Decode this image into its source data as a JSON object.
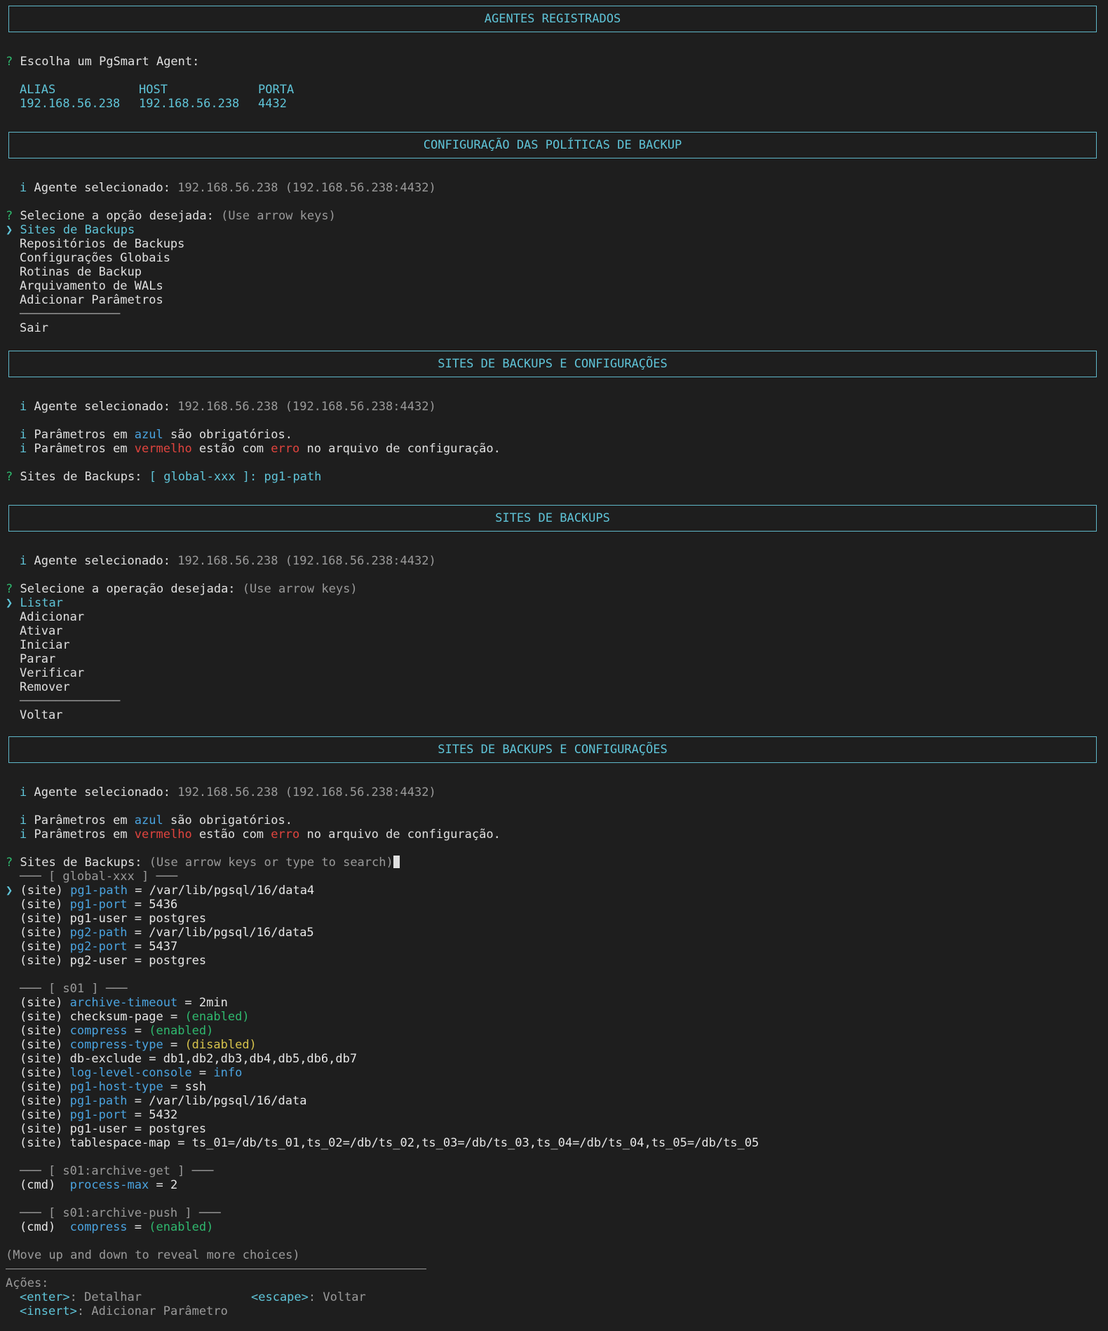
{
  "s1": {
    "title": "AGENTES REGISTRADOS",
    "q_mark": "?",
    "prompt": "Escolha um PgSmart Agent:",
    "cols": [
      "ALIAS",
      "HOST",
      "PORTA"
    ],
    "row": [
      "192.168.56.238",
      "192.168.56.238",
      "4432"
    ]
  },
  "s2": {
    "title": "CONFIGURAÇÃO DAS POLÍTICAS DE BACKUP",
    "info_mark": "i",
    "agent_label": "Agente selecionado:",
    "agent_value": "192.168.56.238 (192.168.56.238:4432)",
    "q_mark": "?",
    "prompt": "Selecione a opção desejada:",
    "hint": "(Use arrow keys)",
    "pointer": "❯",
    "options": [
      "Sites de Backups",
      "Repositórios de Backups",
      "Configurações Globais",
      "Rotinas de Backup",
      "Arquivamento de WALs",
      "Adicionar Parâmetros"
    ],
    "separator": "──────────────",
    "exit": "Sair"
  },
  "s3": {
    "title": "SITES DE BACKUPS E CONFIGURAÇÕES",
    "info_mark": "i",
    "agent_label": "Agente selecionado:",
    "agent_value": "192.168.56.238 (192.168.56.238:4432)",
    "p1_pre": "Parâmetros em ",
    "p1_color": "azul",
    "p1_post": " são obrigatórios.",
    "p2_pre": "Parâmetros em ",
    "p2_color": "vermelho",
    "p2_mid": " estão com ",
    "p2_err": "erro",
    "p2_post": " no arquivo de configuração.",
    "q_mark": "?",
    "prompt": "Sites de Backups:",
    "answer": "[ global-xxx ]: pg1-path"
  },
  "s4": {
    "title": "SITES DE BACKUPS",
    "info_mark": "i",
    "agent_label": "Agente selecionado:",
    "agent_value": "192.168.56.238 (192.168.56.238:4432)",
    "q_mark": "?",
    "prompt": "Selecione a operação desejada:",
    "hint": "(Use arrow keys)",
    "pointer": "❯",
    "options": [
      "Listar",
      "Adicionar",
      "Ativar",
      "Iniciar",
      "Parar",
      "Verificar",
      "Remover"
    ],
    "separator": "──────────────",
    "back": "Voltar"
  },
  "s5": {
    "title": "SITES DE BACKUPS E CONFIGURAÇÕES",
    "info_mark": "i",
    "agent_label": "Agente selecionado:",
    "agent_value": "192.168.56.238 (192.168.56.238:4432)",
    "p1_pre": "Parâmetros em ",
    "p1_color": "azul",
    "p1_post": " são obrigatórios.",
    "p2_pre": "Parâmetros em ",
    "p2_color": "vermelho",
    "p2_mid": " estão com ",
    "p2_err": "erro",
    "p2_post": " no arquivo de configuração.",
    "q_mark": "?",
    "prompt": "Sites de Backups:",
    "hint": "(Use arrow keys or type to search)",
    "pointer": "❯",
    "groups": [
      {
        "header": "─── [ global-xxx ] ───",
        "items": [
          {
            "tag": "(site) ",
            "key": "pg1-path",
            "kc": "blue",
            "eq": " = ",
            "val": "/var/lib/pgsql/16/data4",
            "vc": "white",
            "sel": true
          },
          {
            "tag": "(site) ",
            "key": "pg1-port",
            "kc": "blue",
            "eq": " = ",
            "val": "5436",
            "vc": "white"
          },
          {
            "tag": "(site) ",
            "key": "pg1-user",
            "kc": "white",
            "eq": " = ",
            "val": "postgres",
            "vc": "white"
          },
          {
            "tag": "(site) ",
            "key": "pg2-path",
            "kc": "blue",
            "eq": " = ",
            "val": "/var/lib/pgsql/16/data5",
            "vc": "white"
          },
          {
            "tag": "(site) ",
            "key": "pg2-port",
            "kc": "blue",
            "eq": " = ",
            "val": "5437",
            "vc": "white"
          },
          {
            "tag": "(site) ",
            "key": "pg2-user",
            "kc": "white",
            "eq": " = ",
            "val": "postgres",
            "vc": "white"
          }
        ]
      },
      {
        "header": "─── [ s01 ] ───",
        "items": [
          {
            "tag": "(site) ",
            "key": "archive-timeout",
            "kc": "blue",
            "eq": " = ",
            "val": "2min",
            "vc": "white"
          },
          {
            "tag": "(site) ",
            "key": "checksum-page",
            "kc": "white",
            "eq": " = ",
            "val": "(enabled)",
            "vc": "green"
          },
          {
            "tag": "(site) ",
            "key": "compress",
            "kc": "blue",
            "eq": " = ",
            "val": "(enabled)",
            "vc": "green"
          },
          {
            "tag": "(site) ",
            "key": "compress-type",
            "kc": "blue",
            "eq": " = ",
            "val": "(disabled)",
            "vc": "yellow"
          },
          {
            "tag": "(site) ",
            "key": "db-exclude",
            "kc": "white",
            "eq": " = ",
            "val": "db1,db2,db3,db4,db5,db6,db7",
            "vc": "white"
          },
          {
            "tag": "(site) ",
            "key": "log-level-console",
            "kc": "blue",
            "eq": " = ",
            "val": "info",
            "vc": "blue"
          },
          {
            "tag": "(site) ",
            "key": "pg1-host-type",
            "kc": "blue",
            "eq": " = ",
            "val": "ssh",
            "vc": "white"
          },
          {
            "tag": "(site) ",
            "key": "pg1-path",
            "kc": "blue",
            "eq": " = ",
            "val": "/var/lib/pgsql/16/data",
            "vc": "white"
          },
          {
            "tag": "(site) ",
            "key": "pg1-port",
            "kc": "blue",
            "eq": " = ",
            "val": "5432",
            "vc": "white"
          },
          {
            "tag": "(site) ",
            "key": "pg1-user",
            "kc": "white",
            "eq": " = ",
            "val": "postgres",
            "vc": "white"
          },
          {
            "tag": "(site) ",
            "key": "tablespace-map",
            "kc": "white",
            "eq": " = ",
            "val": "ts_01=/db/ts_01,ts_02=/db/ts_02,ts_03=/db/ts_03,ts_04=/db/ts_04,ts_05=/db/ts_05",
            "vc": "white"
          }
        ]
      },
      {
        "header": "─── [ s01:archive-get ] ───",
        "items": [
          {
            "tag": "(cmd)  ",
            "key": "process-max",
            "kc": "blue",
            "eq": " = ",
            "val": "2",
            "vc": "white"
          }
        ]
      },
      {
        "header": "─── [ s01:archive-push ] ───",
        "items": [
          {
            "tag": "(cmd)  ",
            "key": "compress",
            "kc": "blue",
            "eq": " = ",
            "val": "(enabled)",
            "vc": "green"
          }
        ]
      }
    ],
    "more": "(Move up and down to reveal more choices)",
    "actions_label": "Ações:",
    "actions": [
      {
        "key": "<enter>",
        "desc": ": Detalhar"
      },
      {
        "key": "<escape>",
        "desc": ": Voltar"
      },
      {
        "key": "<insert>",
        "desc": ": Adicionar Parâmetro"
      }
    ]
  }
}
